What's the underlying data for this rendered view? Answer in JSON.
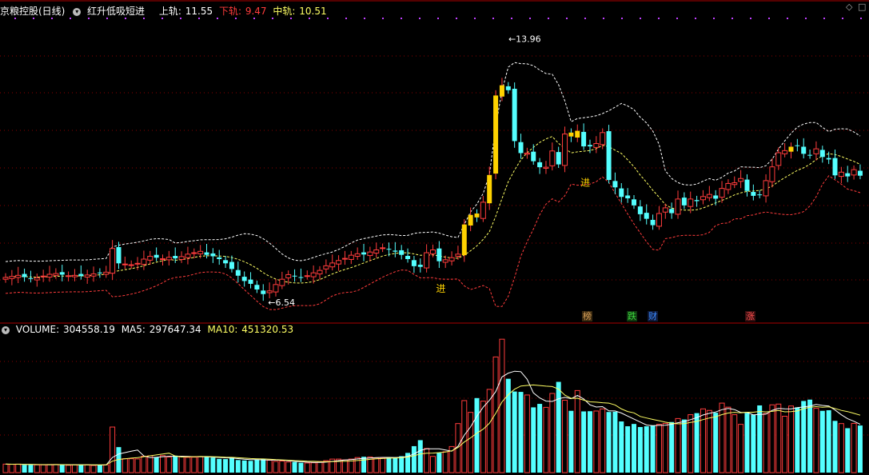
{
  "header": {
    "title": "京粮控股(日线)",
    "indicator": "红升低吸短进",
    "upper_label": "上轨:",
    "upper_value": "11.55",
    "lower_label": "下轨:",
    "lower_value": "9.47",
    "mid_label": "中轨:",
    "mid_value": "10.51"
  },
  "volume_header": {
    "label": "VOLUME:",
    "value": "304558.19",
    "ma5_label": "MA5:",
    "ma5_value": "297647.34",
    "ma10_label": "MA10:",
    "ma10_value": "451320.53"
  },
  "annotations": {
    "high": "13.96",
    "low": "6.54",
    "signal": "进"
  },
  "events": [
    {
      "text": "榜",
      "color": "#d9a05a"
    },
    {
      "text": "跌",
      "color": "#3cd53c"
    },
    {
      "text": "财",
      "color": "#3c8cff"
    },
    {
      "text": "涨",
      "color": "#ff5050"
    }
  ],
  "colors": {
    "up": "#ff3c3c",
    "down": "#54ffff",
    "signal_bar": "#ffd200",
    "upper_band": "#ffffff",
    "mid_band": "#ffff64",
    "lower_band": "#ff3c3c",
    "ma5": "#ffffff",
    "ma10": "#ffff64",
    "grid": "#8b0000"
  },
  "chart_data": [
    {
      "type": "candlestick",
      "ylim": [
        6.0,
        14.6
      ],
      "high": 13.96,
      "low": 6.54,
      "upper_band_last": 11.55,
      "mid_band_last": 10.51,
      "lower_band_last": 9.47,
      "closes": [
        7.2,
        7.23,
        7.26,
        7.21,
        7.16,
        7.19,
        7.24,
        7.29,
        7.31,
        7.28,
        7.25,
        7.26,
        7.24,
        7.27,
        7.3,
        7.32,
        7.35,
        8.02,
        7.6,
        7.58,
        7.56,
        7.6,
        7.72,
        7.8,
        7.76,
        7.73,
        7.77,
        7.74,
        7.79,
        7.86,
        7.9,
        7.94,
        7.84,
        7.8,
        7.72,
        7.6,
        7.44,
        7.25,
        7.1,
        7.02,
        6.86,
        6.73,
        6.82,
        7.0,
        7.15,
        7.28,
        7.24,
        7.2,
        7.25,
        7.33,
        7.4,
        7.53,
        7.61,
        7.68,
        7.74,
        7.83,
        7.87,
        7.85,
        7.92,
        7.98,
        8.04,
        7.99,
        7.93,
        7.84,
        7.72,
        7.52,
        7.5,
        7.9,
        7.98,
        7.66,
        7.7,
        7.76,
        7.86,
        8.7,
        8.97,
        8.9,
        9.33,
        10.1,
        12.35,
        12.64,
        12.5,
        11.06,
        10.72,
        10.72,
        10.49,
        10.32,
        10.32,
        10.78,
        10.4,
        11.26,
        11.19,
        11.35,
        10.91,
        10.91,
        10.99,
        11.3,
        9.96,
        9.75,
        9.48,
        9.44,
        9.24,
        8.99,
        8.86,
        8.68,
        9.01,
        9.17,
        9.02,
        9.42,
        9.24,
        9.42,
        9.36,
        9.49,
        9.55,
        9.43,
        9.72,
        9.86,
        9.88,
        10.0,
        9.65,
        9.51,
        9.54,
        9.94,
        10.33,
        10.73,
        10.79,
        10.9,
        10.93,
        10.7,
        10.66,
        10.84,
        10.61,
        10.54,
        10.09,
        10.18,
        10.06,
        10.25,
        10.08
      ],
      "volumes": [
        44,
        43,
        44,
        40,
        40,
        40,
        40,
        42,
        42,
        41,
        38,
        40,
        42,
        40,
        37,
        38,
        40,
        236,
        132,
        72,
        72,
        71,
        85,
        87,
        81,
        88,
        81,
        88,
        84,
        79,
        80,
        82,
        82,
        78,
        71,
        70,
        78,
        65,
        63,
        61,
        68,
        72,
        64,
        58,
        60,
        55,
        55,
        51,
        50,
        51,
        57,
        62,
        70,
        70,
        66,
        70,
        78,
        82,
        81,
        76,
        76,
        79,
        79,
        85,
        102,
        137,
        168,
        125,
        84,
        102,
        108,
        135,
        254,
        373,
        312,
        386,
        370,
        431,
        599,
        691,
        486,
        420,
        418,
        402,
        338,
        356,
        338,
        410,
        470,
        375,
        320,
        425,
        317,
        318,
        319,
        330,
        314,
        315,
        265,
        240,
        252,
        236,
        240,
        245,
        250,
        255,
        262,
        280,
        275,
        300,
        308,
        330,
        322,
        310,
        360,
        339,
        300,
        250,
        309,
        300,
        348,
        306,
        351,
        355,
        292,
        345,
        338,
        371,
        378,
        333,
        320,
        323,
        268,
        254,
        230,
        255,
        244
      ],
      "ma5_last": 297647.34,
      "ma10_last": 451320.53,
      "volume_last": 304558.19
    }
  ]
}
